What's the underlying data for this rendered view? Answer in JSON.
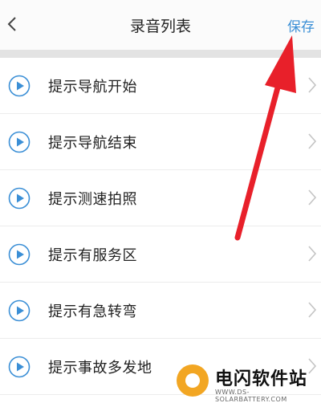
{
  "header": {
    "title": "录音列表",
    "save_label": "保存",
    "back_icon": "chevron-left-icon"
  },
  "items": [
    {
      "label": "提示导航开始"
    },
    {
      "label": "提示导航结束"
    },
    {
      "label": "提示测速拍照"
    },
    {
      "label": "提示有服务区"
    },
    {
      "label": "提示有急转弯"
    },
    {
      "label": "提示事故多发地"
    }
  ],
  "watermark": {
    "name": "电闪软件站",
    "url": "WWW.DS-SOLARBATTERY.COM"
  },
  "colors": {
    "accent": "#3b8fd6",
    "annotation_arrow": "#e8202a"
  }
}
